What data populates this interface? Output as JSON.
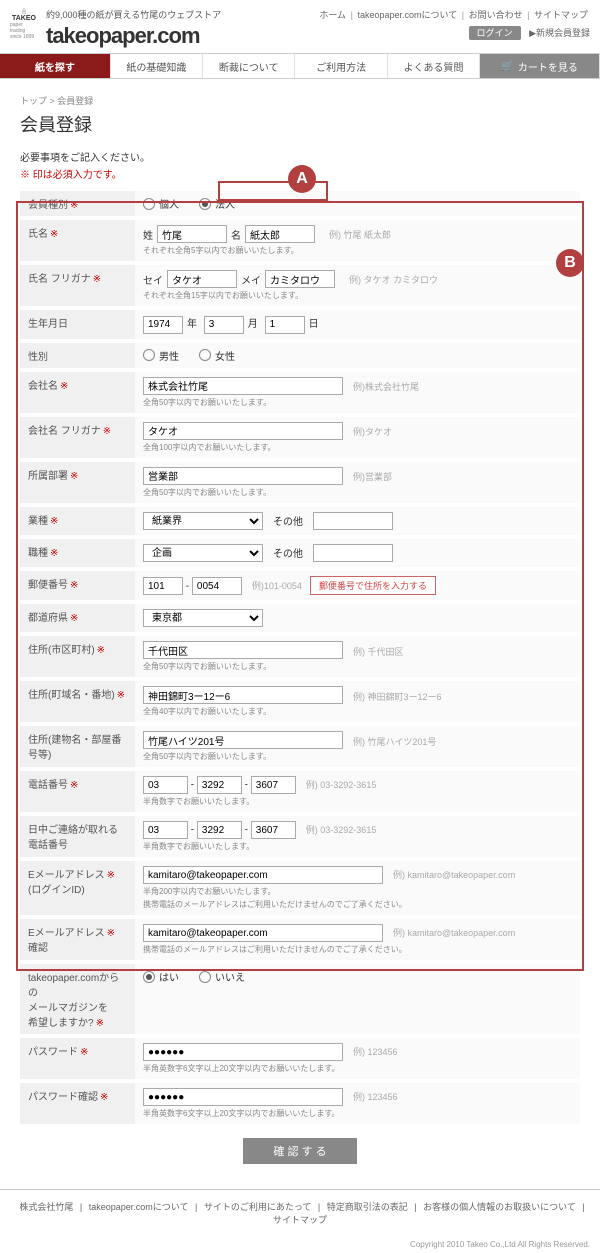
{
  "header": {
    "tagline": "約9,000種の紙が買える竹尾のウェブストア",
    "site_name": "takeopaper.com",
    "logo_text": "TAKEO",
    "logo_sub": "paper trading since 1899"
  },
  "topnav": {
    "home": "ホーム",
    "about": "takeopaper.comについて",
    "contact": "お問い合わせ",
    "sitemap": "サイトマップ",
    "login": "ログイン",
    "register": "▶新規会員登録"
  },
  "mainnav": {
    "search": "紙を探す",
    "basics": "紙の基礎知識",
    "cutting": "断裁について",
    "usage": "ご利用方法",
    "faq": "よくある質問",
    "cart": "カートを見る"
  },
  "breadcrumb": "トップ > 会員登録",
  "page_title": "会員登録",
  "instruction": "必要事項をご記入ください。",
  "required_note": "※ 印は必須入力です。",
  "markers": {
    "a": "A",
    "b": "B"
  },
  "fields": {
    "member_type": {
      "label": "会員種別",
      "req": "※",
      "opt1": "個人",
      "opt2": "法人"
    },
    "name": {
      "label": "氏名",
      "req": "※",
      "sei_label": "姓",
      "sei": "竹尾",
      "mei_label": "名",
      "mei": "紙太郎",
      "example": "例) 竹尾 紙太郎",
      "hint": "それぞれ全角5字以内でお願いいたします。"
    },
    "kana": {
      "label": "氏名 フリガナ",
      "req": "※",
      "sei_label": "セイ",
      "sei": "タケオ",
      "mei_label": "メイ",
      "mei": "カミタロウ",
      "example": "例) タケオ カミタロウ",
      "hint": "それぞれ全角15字以内でお願いいたします。"
    },
    "birth": {
      "label": "生年月日",
      "year": "1974",
      "month": "3",
      "day": "1",
      "y": "年",
      "m": "月",
      "d": "日"
    },
    "gender": {
      "label": "性別",
      "opt1": "男性",
      "opt2": "女性"
    },
    "company": {
      "label": "会社名",
      "req": "※",
      "value": "株式会社竹尾",
      "example": "例)株式会社竹尾",
      "hint": "全角50字以内でお願いいたします。"
    },
    "company_kana": {
      "label": "会社名 フリガナ",
      "req": "※",
      "value": "タケオ",
      "example": "例)タケオ",
      "hint": "全角100字以内でお願いいたします。"
    },
    "dept": {
      "label": "所属部署",
      "req": "※",
      "value": "営業部",
      "example": "例)営業部",
      "hint": "全角50字以内でお願いいたします。"
    },
    "industry": {
      "label": "業種",
      "req": "※",
      "value": "紙業界",
      "other": "その他"
    },
    "job": {
      "label": "職種",
      "req": "※",
      "value": "企画",
      "other": "その他"
    },
    "zip": {
      "label": "郵便番号",
      "req": "※",
      "p1": "101",
      "p2": "0054",
      "example": "例)101-0054",
      "btn": "郵便番号で住所を入力する"
    },
    "pref": {
      "label": "都道府県",
      "req": "※",
      "value": "東京都"
    },
    "city": {
      "label": "住所(市区町村)",
      "req": "※",
      "value": "千代田区",
      "example": "例) 千代田区",
      "hint": "全角50字以内でお願いいたします。"
    },
    "addr": {
      "label": "住所(町域名・番地)",
      "req": "※",
      "value": "神田錦町3ー12ー6",
      "example": "例) 神田錦町3ー12ー6",
      "hint": "全角40字以内でお願いいたします。"
    },
    "bldg": {
      "label": "住所(建物名・部屋番号等)",
      "value": "竹尾ハイツ201号",
      "example": "例) 竹尾ハイツ201号",
      "hint": "全角50字以内でお願いいたします。"
    },
    "tel": {
      "label": "電話番号",
      "req": "※",
      "p1": "03",
      "p2": "3292",
      "p3": "3607",
      "example": "例) 03-3292-3615",
      "hint": "半角数字でお願いいたします。"
    },
    "tel2": {
      "label": "日中ご連絡が取れる電話番号",
      "p1": "03",
      "p2": "3292",
      "p3": "3607",
      "example": "例) 03-3292-3615",
      "hint": "半角数字でお願いいたします。"
    },
    "email": {
      "label": "Eメールアドレス",
      "label2": "(ログインID)",
      "req": "※",
      "value": "kamitaro@takeopaper.com",
      "example": "例) kamitaro@takeopaper.com",
      "hint1": "半角200字以内でお願いいたします。",
      "hint2": "携帯電話のメールアドレスはご利用いただけませんのでご了承ください。"
    },
    "email2": {
      "label": "Eメールアドレス",
      "label2": "確認",
      "req": "※",
      "value": "kamitaro@takeopaper.com",
      "example": "例) kamitaro@takeopaper.com",
      "hint": "携帯電話のメールアドレスはご利用いただけませんのでご了承ください。"
    },
    "mag": {
      "label1": "takeopaper.comからの",
      "label2": "メールマガジンを",
      "label3": "希望しますか?",
      "req": "※",
      "opt1": "はい",
      "opt2": "いいえ"
    },
    "pwd": {
      "label": "パスワード",
      "req": "※",
      "value": "●●●●●●",
      "example": "例) 123456",
      "hint": "半角英数字6文字以上20文字以内でお願いいたします。"
    },
    "pwd2": {
      "label": "パスワード確認",
      "req": "※",
      "value": "●●●●●●",
      "example": "例) 123456",
      "hint": "半角英数字6文字以上20文字以内でお願いいたします。"
    }
  },
  "submit": "確 認 す る",
  "footer": {
    "company": "株式会社竹尾",
    "about": "takeopaper.comについて",
    "terms": "サイトのご利用にあたって",
    "law": "特定商取引法の表記",
    "privacy": "お客様の個人情報のお取扱いについて",
    "sitemap": "サイトマップ",
    "copyright": "Copyright 2010 Takeo Co.,Ltd All Rights Reserved."
  }
}
